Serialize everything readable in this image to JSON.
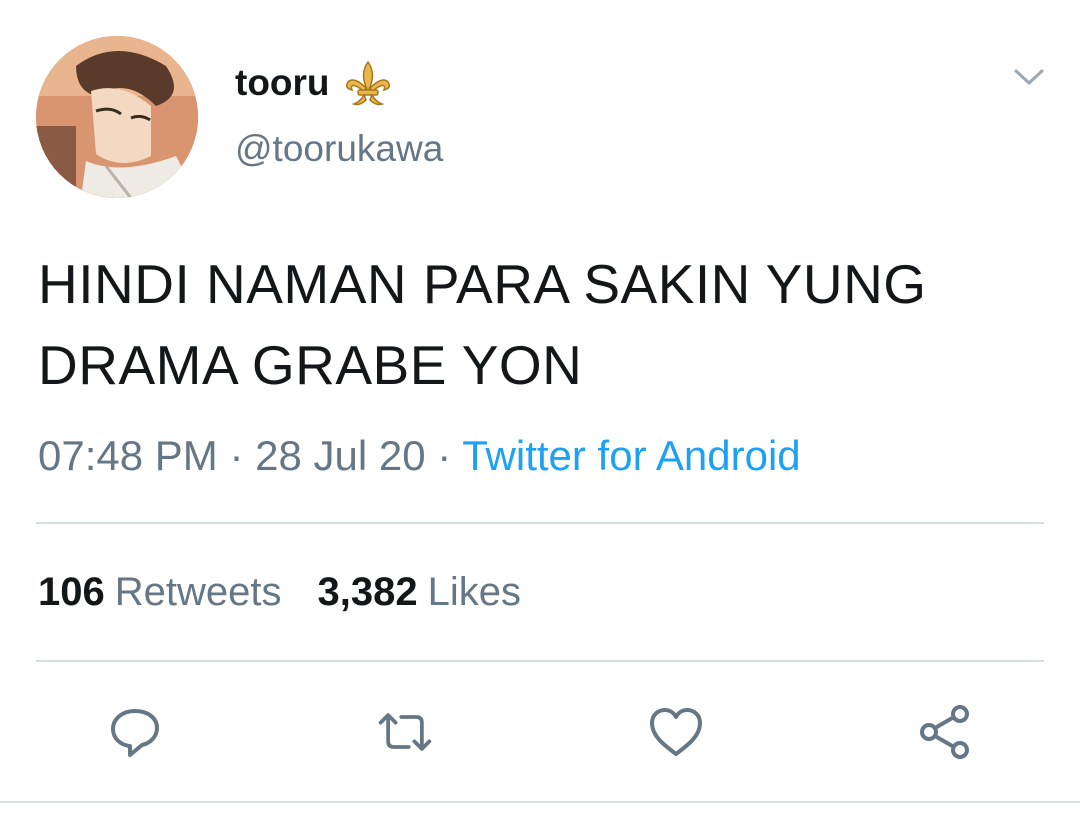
{
  "user": {
    "display_name": "tooru",
    "handle": "@toorukawa",
    "avatar_icon": "anime-avatar",
    "badge_icon": "fleur-de-lis-icon"
  },
  "tweet": {
    "text_line1": "HINDI NAMAN PARA SAKIN YUNG",
    "text_line2": "DRAMA GRABE YON"
  },
  "meta": {
    "time": "07:48 PM",
    "sep1": "·",
    "date": "28 Jul 20",
    "sep2": "·",
    "source": "Twitter for Android"
  },
  "stats": {
    "retweets_count": "106",
    "retweets_label": "Retweets",
    "likes_count": "3,382",
    "likes_label": "Likes"
  },
  "actions": [
    "reply-icon",
    "retweet-icon",
    "like-icon",
    "share-icon"
  ],
  "colors": {
    "text": "#14171a",
    "secondary": "#657786",
    "link": "#1da1f2",
    "divider": "#d6dde3",
    "badge": "#d9a83c"
  }
}
